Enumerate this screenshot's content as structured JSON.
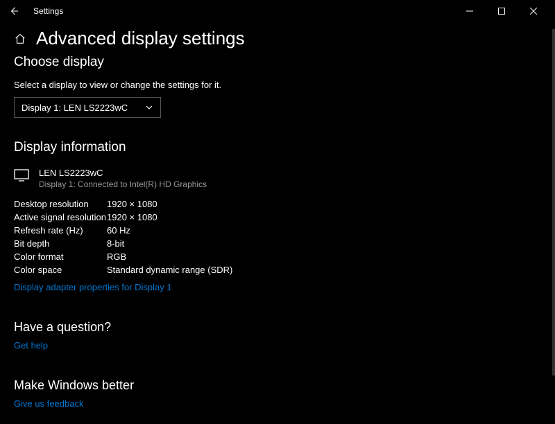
{
  "titlebar": {
    "app_name": "Settings"
  },
  "page": {
    "title": "Advanced display settings"
  },
  "choose": {
    "heading": "Choose display",
    "subtext": "Select a display to view or change the settings for it.",
    "selected": "Display 1: LEN LS2223wC"
  },
  "info": {
    "heading": "Display information",
    "monitor_name": "LEN LS2223wC",
    "monitor_sub": "Display 1: Connected to Intel(R) HD Graphics",
    "rows": [
      {
        "label": "Desktop resolution",
        "value": "1920 × 1080"
      },
      {
        "label": "Active signal resolution",
        "value": "1920 × 1080"
      },
      {
        "label": "Refresh rate (Hz)",
        "value": "60 Hz"
      },
      {
        "label": "Bit depth",
        "value": "8-bit"
      },
      {
        "label": "Color format",
        "value": "RGB"
      },
      {
        "label": "Color space",
        "value": "Standard dynamic range (SDR)"
      }
    ],
    "adapter_link": "Display adapter properties for Display 1"
  },
  "question": {
    "heading": "Have a question?",
    "link": "Get help"
  },
  "feedback": {
    "heading": "Make Windows better",
    "link": "Give us feedback"
  }
}
